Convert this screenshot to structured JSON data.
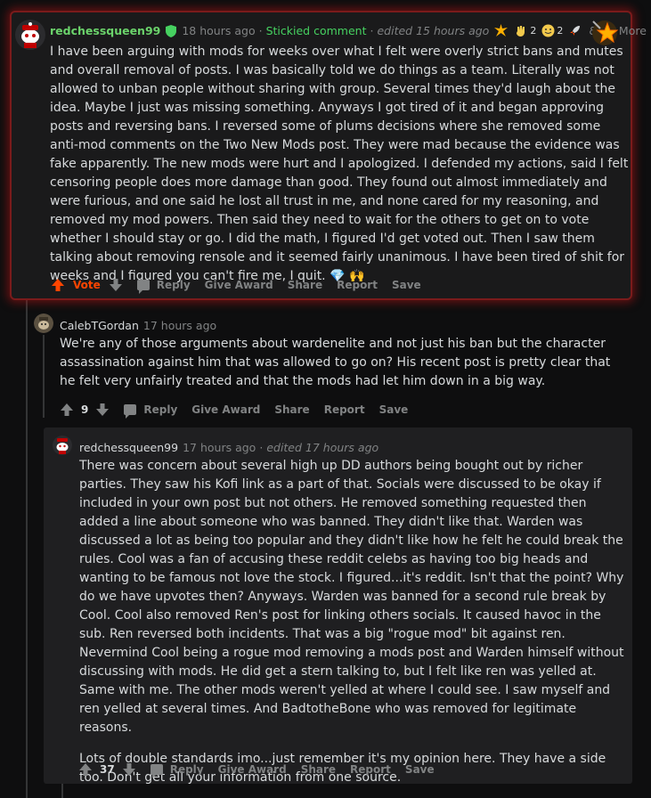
{
  "comments": [
    {
      "author": "redchessqueen99",
      "time": "18 hours ago",
      "stickied": "Stickied comment",
      "edited": "edited 15 hours ago",
      "awards": [
        {
          "icon": "explosion-award-icon",
          "count": ""
        },
        {
          "icon": "hand-award-icon",
          "count": "2"
        },
        {
          "icon": "wholesome-award-icon",
          "count": "2"
        },
        {
          "icon": "rocket-award-icon",
          "count": ""
        }
      ],
      "more_awards": "& 27 More",
      "body": [
        "I have been arguing with mods for weeks over what I felt were overly strict bans and mutes and overall removal of posts. I was basically told we do things as a team. Literally was not allowed to unban people without sharing with group. Several times they'd laugh about the idea. Maybe I just was missing something. Anyways I got tired of it and began approving posts and reversing bans. I reversed some of plums decisions where she removed some anti-mod comments on the Two New Mods post. They were mad because the evidence was fake apparently. The new mods were hurt and I apologized. I defended my actions, said I felt censoring people does more damage than good. They found out almost immediately and were furious, and one said he lost all trust in me, and none cared for my reasoning, and removed my mod powers. Then said they need to wait for the others to get on to vote whether I should stay or go. I did the math, I figured I'd get voted out. Then I saw them talking about removing rensole and it seemed fairly unanimous. I have been tired of shit for weeks and I figured you can't fire me, I quit. 💎 🙌"
      ],
      "vote_label": "Vote",
      "actions": [
        "Reply",
        "Give Award",
        "Share",
        "Report",
        "Save"
      ]
    },
    {
      "author": "CalebTGordan",
      "time": "17 hours ago",
      "body": [
        "We're any of those arguments about wardenelite and not just his ban but the character assassination against him that was allowed to go on? His recent post is pretty clear that he felt very unfairly treated and that the mods had let him down in a big way."
      ],
      "score": "9",
      "actions": [
        "Reply",
        "Give Award",
        "Share",
        "Report",
        "Save"
      ]
    },
    {
      "author": "redchessqueen99",
      "time": "17 hours ago",
      "edited": "edited 17 hours ago",
      "body": [
        "There was concern about several high up DD authors being bought out by richer parties. They saw his Kofi link as a part of that. Socials were discussed to be okay if included in your own post but not others. He removed something requested then added a line about someone who was banned. They didn't like that. Warden was discussed a lot as being too popular and they didn't like how he felt he could break the rules. Cool was a fan of accusing these reddit celebs as having too big heads and wanting to be famous not love the stock. I figured...it's reddit. Isn't that the point? Why do we have upvotes then? Anyways. Warden was banned for a second rule break by Cool. Cool also removed Ren's post for linking others socials. It caused havoc in the sub. Ren reversed both incidents. That was a big \"rogue mod\" bit against ren. Nevermind Cool being a rogue mod removing a mods post and Warden himself without discussing with mods. He did get a stern talking to, but I felt like ren was yelled at. Same with me. The other mods weren't yelled at where I could see. I saw myself and ren yelled at several times. And BadtotheBone who was removed for legitimate reasons.",
        "Lots of double standards imo...just remember it's my opinion here. They have a side too. Don't get all your information from one source."
      ],
      "score": "37",
      "actions": [
        "Reply",
        "Give Award",
        "Share",
        "Report",
        "Save"
      ]
    }
  ],
  "colors": {
    "background": "#0e0e0f",
    "card": "#1a1a1b",
    "nested_card": "#1f1f21",
    "stickied_glow": "#aa1414",
    "stickied_text": "#46d160",
    "upvote_active": "#ff4500",
    "muted": "#818384"
  }
}
